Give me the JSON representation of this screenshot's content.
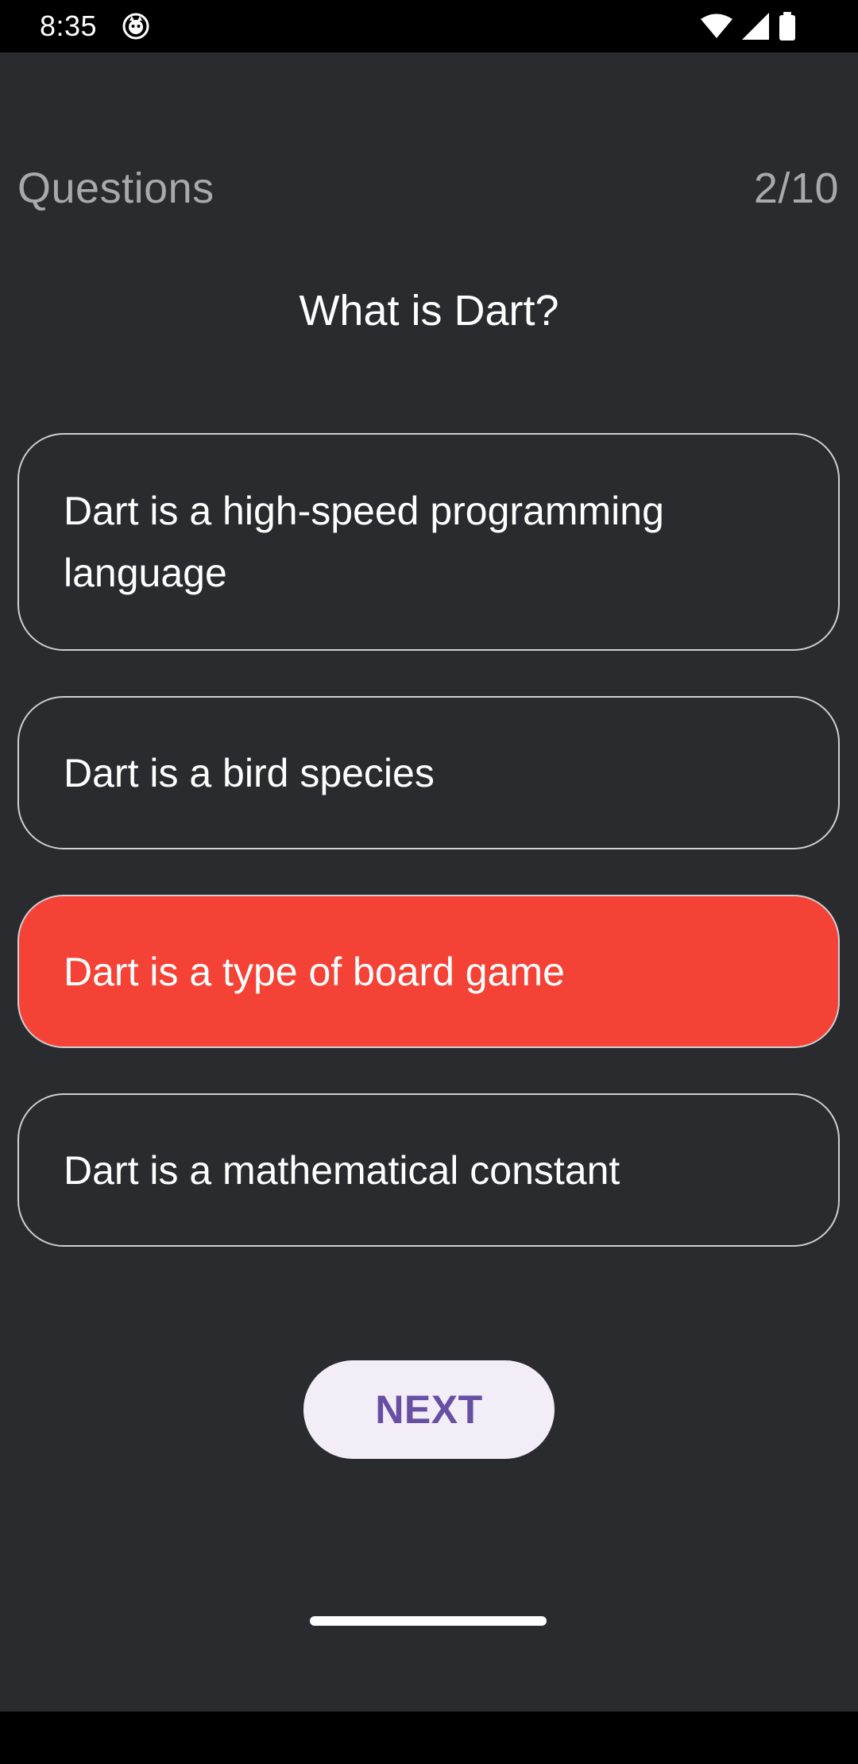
{
  "status_bar": {
    "time": "8:35",
    "icons": [
      "app-notification-icon",
      "wifi-icon",
      "cellular-signal-icon",
      "battery-icon"
    ]
  },
  "header": {
    "title": "Questions",
    "counter": "2/10"
  },
  "question": {
    "text": "What is Dart?"
  },
  "options": [
    {
      "label": "Dart is a high-speed programming language",
      "state": "default"
    },
    {
      "label": "Dart is a bird species",
      "state": "default"
    },
    {
      "label": "Dart is a type of board game",
      "state": "selected-wrong"
    },
    {
      "label": "Dart is a mathematical constant",
      "state": "default"
    }
  ],
  "next_button": {
    "label": "NEXT"
  },
  "colors": {
    "background": "#2a2b2e",
    "wrong_answer": "#f44336",
    "option_border": "#cfcfd3",
    "button_bg": "#f3edf7",
    "button_text": "#6750a4",
    "muted_text": "#a8a9ad"
  }
}
